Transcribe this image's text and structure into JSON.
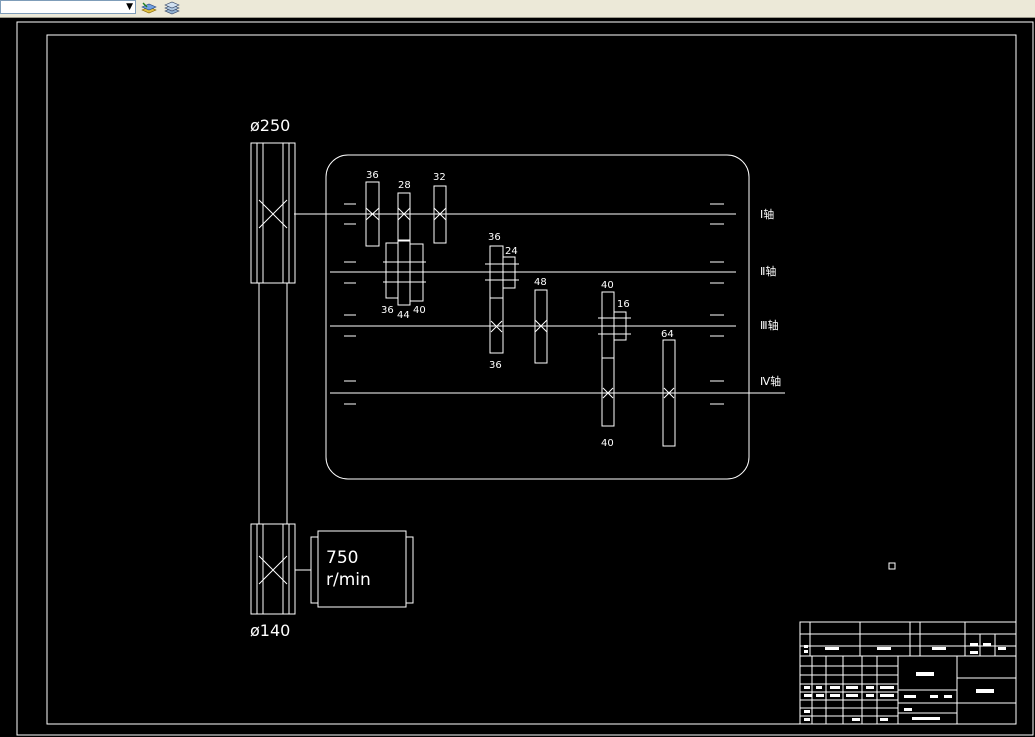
{
  "toolbar": {
    "layer_combo_value": "",
    "icons": [
      "layer-manager-icon",
      "layer-states-icon"
    ]
  },
  "drawing": {
    "pulley_top_dia": "ø250",
    "pulley_bottom_dia": "ø140",
    "motor_speed_value": "750",
    "motor_speed_unit": "r/min",
    "shaft_labels": [
      "Ⅰ轴",
      "Ⅱ轴",
      "Ⅲ轴",
      "Ⅳ轴"
    ],
    "gear_teeth": {
      "g1": "36",
      "g2": "28",
      "g3": "32",
      "g4": "36",
      "g5": "44",
      "g6": "40",
      "g7": "36",
      "g8": "24",
      "g9": "36",
      "g10": "48",
      "g11": "40",
      "g12": "16",
      "g13": "64",
      "g14": "40"
    }
  },
  "colors": {
    "background": "#000000",
    "linework": "#ffffff",
    "toolbar": "#ece9d8"
  }
}
